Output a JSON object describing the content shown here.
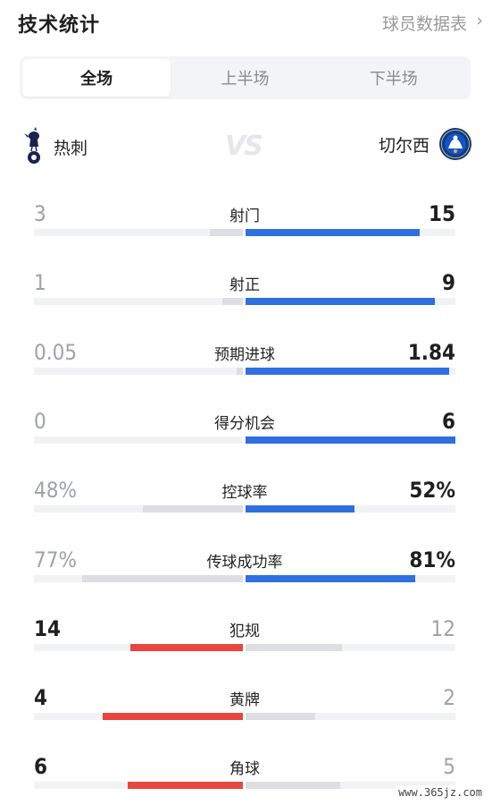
{
  "header": {
    "title": "技术统计",
    "player_link": "球员数据表",
    "chevron": "›"
  },
  "tabs": [
    {
      "label": "全场",
      "active": true
    },
    {
      "label": "上半场",
      "active": false
    },
    {
      "label": "下半场",
      "active": false
    }
  ],
  "teams": {
    "home": {
      "name": "热刺",
      "crest_icon": "tottenham-crest-icon"
    },
    "vs_text": "VS",
    "away": {
      "name": "切尔西",
      "crest_icon": "chelsea-crest-icon"
    }
  },
  "colors": {
    "leader_blue": "#2f6fe0",
    "leader_red": "#e8463e",
    "trailing_grey": "#dcdee2"
  },
  "stats": [
    {
      "label": "射门",
      "home": "3",
      "away": "15",
      "home_frac": 0.16,
      "away_frac": 0.83,
      "leader": "away",
      "color": "blue"
    },
    {
      "label": "射正",
      "home": "1",
      "away": "9",
      "home_frac": 0.1,
      "away_frac": 0.9,
      "leader": "away",
      "color": "blue"
    },
    {
      "label": "预期进球",
      "home": "0.05",
      "away": "1.84",
      "home_frac": 0.03,
      "away_frac": 0.97,
      "leader": "away",
      "color": "blue"
    },
    {
      "label": "得分机会",
      "home": "0",
      "away": "6",
      "home_frac": 0.0,
      "away_frac": 1.0,
      "leader": "away",
      "color": "blue"
    },
    {
      "label": "控球率",
      "home": "48%",
      "away": "52%",
      "home_frac": 0.48,
      "away_frac": 0.52,
      "leader": "away",
      "color": "blue"
    },
    {
      "label": "传球成功率",
      "home": "77%",
      "away": "81%",
      "home_frac": 0.77,
      "away_frac": 0.81,
      "leader": "away",
      "color": "blue"
    },
    {
      "label": "犯规",
      "home": "14",
      "away": "12",
      "home_frac": 0.54,
      "away_frac": 0.46,
      "leader": "home",
      "color": "red"
    },
    {
      "label": "黄牌",
      "home": "4",
      "away": "2",
      "home_frac": 0.67,
      "away_frac": 0.33,
      "leader": "home",
      "color": "red"
    },
    {
      "label": "角球",
      "home": "6",
      "away": "5",
      "home_frac": 0.55,
      "away_frac": 0.45,
      "leader": "home",
      "color": "red"
    }
  ],
  "watermark": "www.365jz.com"
}
